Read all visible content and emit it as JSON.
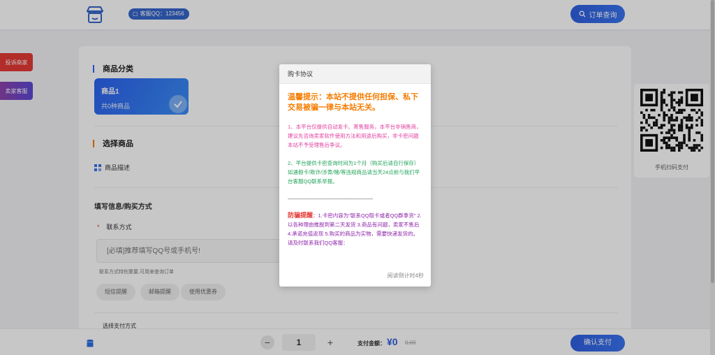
{
  "header": {
    "qq_badge": "客服QQ：123456",
    "order_query_label": "订单查询"
  },
  "side_buttons": {
    "complain": "投诉商家",
    "seller_service": "卖家客服"
  },
  "categories": {
    "title": "商品分类",
    "items": [
      {
        "name": "商品1",
        "count": "共0种商品"
      }
    ]
  },
  "select_product": {
    "title": "选择商品",
    "desc_label": "商品描述"
  },
  "fill_info": {
    "title": "填写信息/购买方式",
    "contact_label": "联系方式",
    "contact_placeholder": "[必填]推荐填写QQ号或手机号!",
    "contact_hint": "联系方式特别重要,可用来查询订单",
    "chips": [
      "短信提醒",
      "邮箱提醒",
      "使用优惠券"
    ],
    "pay_title": "选择支付方式"
  },
  "qr": {
    "caption": "手机扫码支付"
  },
  "bottom": {
    "quantity": "1",
    "minus": "−",
    "plus": "+",
    "total_label": "支付金额：",
    "total_value": "¥0",
    "total_old": "0.00",
    "confirm_label": "确认支付"
  },
  "modal": {
    "title": "购卡协议",
    "warning": "温馨提示：本站不提供任何担保、私下交易被骗一律与本站无关。",
    "para1": "1、本平台仅提供自动发卡、寄售服务，本平台非销售商，建议先咨询卖家软件使用方法和用途后购买，非卡密问题本站不予受理售后争议。",
    "para2": "2、平台提供卡密查询时间为1个月（购买后请自行保存）如遇假卡/欺诈/涉黄/赌/等违规商品请当天24点前与我们平台客服QQ联系举报。",
    "dashes": "-------------------------------------------------------------",
    "fraud_label": "防骗提醒",
    "fraud_text": "：1.卡密内容为\"联系QQ取卡或者QQ群拿货\" 2.以各种理由推脱到第二天发货 3.商品有问题，卖家不售后 4.承诺充值返现 5.购买的商品为实物，需要快递发货的。请及时联系我们QQ客服：",
    "countdown": "阅读倒计时4秒"
  },
  "colors": {
    "accent": "#2f5fe0",
    "warning_orange": "#f57c00",
    "pink": "#e040a0",
    "green": "#21a35a",
    "purple": "#8e24aa",
    "red": "#e53935"
  }
}
